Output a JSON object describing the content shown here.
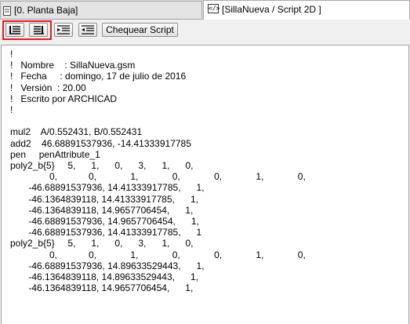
{
  "tabs": [
    {
      "label": "[0. Planta Baja]",
      "icon": "floor-plan-icon",
      "active": false
    },
    {
      "label": "[SillaNueva / Script 2D ]",
      "icon": "script-2d-icon",
      "active": true
    }
  ],
  "toolbar": {
    "buttons": [
      {
        "name": "indent-left-button",
        "icon": "align-left-list-icon"
      },
      {
        "name": "align-lines-button",
        "icon": "align-lines-icon"
      },
      {
        "name": "indent-right-button",
        "icon": "indent-right-icon"
      },
      {
        "name": "outdent-button",
        "icon": "outdent-icon"
      }
    ],
    "check_script_label": "Chequear Script",
    "highlight_color": "#e01c24"
  },
  "editor": {
    "lines": [
      "!",
      "!   Nombre    : SillaNueva.gsm",
      "!   Fecha     : domingo, 17 de julio de 2016",
      "!   Versión  : 20.00",
      "!   Escrito por ARCHICAD",
      "!",
      "",
      "mul2    A/0.552431, B/0.552431",
      "add2    46.68891537936, -14.41333917785",
      "pen     penAttribute_1",
      "poly2_b{5}     5,      1,      0,      3,      1,      0,",
      "               0,            0,             1,             0,             0,             1,             0,",
      "       -46.68891537936, 14.41333917785,      1,",
      "       -46.1364839118, 14.41333917785,      1,",
      "       -46.1364839118, 14.9657706454,      1,",
      "       -46.68891537936, 14.9657706454,      1,",
      "       -46.68891537936, 14.41333917785,      1",
      "poly2_b{5}     5,      1,      0,      3,      1,      0,",
      "               0,            0,             1,             0,             0,             1,             0,",
      "       -46.68891537936, 14.89633529443,      1,",
      "       -46.1364839118, 14.89633529443,      1,",
      "       -46.1364839118, 14.9657706454,      1,"
    ]
  }
}
